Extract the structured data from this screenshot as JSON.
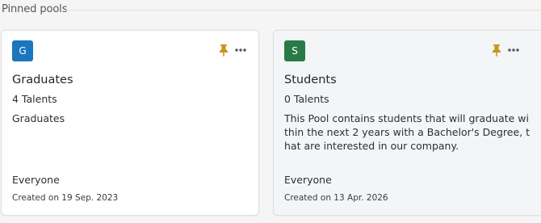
{
  "section": {
    "title": "Pinned pools"
  },
  "icons": {
    "pin": "pin-icon",
    "more": "more-horizontal-icon"
  },
  "colors": {
    "pin": "#c8951c",
    "more": "#55565c"
  },
  "pools": [
    {
      "initial": "G",
      "avatar_color": "#1b76bd",
      "name": "Graduates",
      "talents": "4 Talents",
      "description": "Graduates",
      "visibility": "Everyone",
      "created": "Created on 19 Sep. 2023"
    },
    {
      "initial": "S",
      "avatar_color": "#2a7a45",
      "name": "Students",
      "talents": "0 Talents",
      "description": "This Pool contains students that will graduate within the next 2 years with a Bachelor's Degree, that are interested in our company.",
      "visibility": "Everyone",
      "created": "Created on 13 Apr. 2026"
    }
  ]
}
